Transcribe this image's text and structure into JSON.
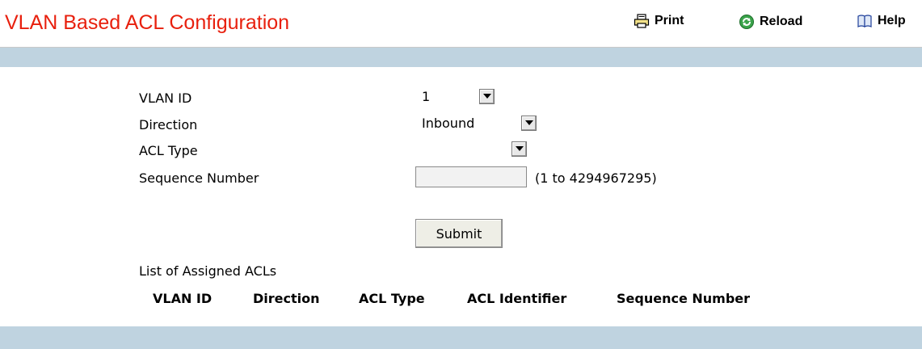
{
  "page": {
    "title": "VLAN Based ACL Configuration"
  },
  "toolbar": {
    "print_label": "Print",
    "reload_label": "Reload",
    "help_label": "Help"
  },
  "form": {
    "vlan_id": {
      "label": "VLAN ID",
      "value": "1"
    },
    "direction": {
      "label": "Direction",
      "value": "Inbound"
    },
    "acl_type": {
      "label": "ACL Type",
      "value": ""
    },
    "sequence_number": {
      "label": "Sequence Number",
      "value": "",
      "hint": "(1 to 4294967295)"
    },
    "submit_label": "Submit"
  },
  "assigned": {
    "heading": "List of Assigned ACLs",
    "columns": [
      "VLAN ID",
      "Direction",
      "ACL Type",
      "ACL Identifier",
      "Sequence Number"
    ],
    "rows": []
  },
  "colors": {
    "title": "#e8200e",
    "band": "#bfd3e0"
  }
}
